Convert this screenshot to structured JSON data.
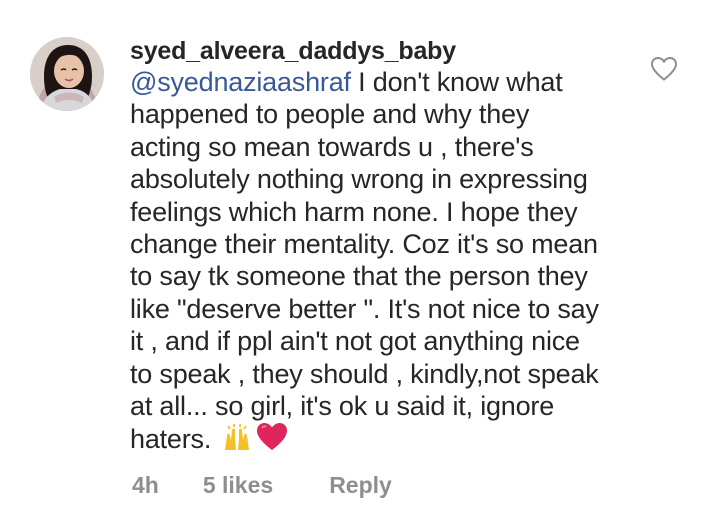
{
  "comment": {
    "username": "syed_alveera_daddys_baby",
    "mention": "@syednaziaashraf",
    "lines": [
      " I don't know what",
      "happened to people and why they",
      "acting so mean towards u , there's",
      "absolutely nothing wrong in expressing",
      "feelings which harm none. I hope they",
      "change their mentality. Coz it's so mean",
      "to say tk someone that the person they",
      "like \"deserve better \". It's not nice to say",
      "it , and if ppl ain't not got anything nice",
      "to speak , they should , kindly,not speak",
      "at all... so girl, it's ok u said it, ignore",
      "haters. "
    ],
    "emojis": [
      "raising-hands-emoji",
      "red-heart-emoji"
    ]
  },
  "footer": {
    "time": "4h",
    "likes": "5 likes",
    "reply": "Reply"
  },
  "icons": {
    "like": "heart-outline-icon"
  },
  "colors": {
    "mention": "#385898",
    "text": "#262626",
    "meta": "#8e8e8e"
  }
}
